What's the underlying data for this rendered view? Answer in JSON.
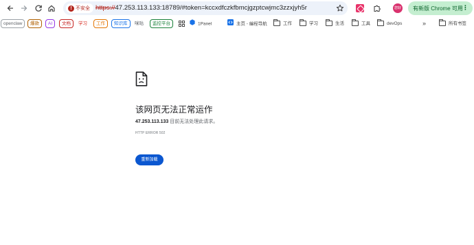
{
  "toolbar": {
    "security_label": "不安全",
    "url_scheme": "https://",
    "url_rest": "47.253.113.133:18789/#token=kccxdfczkfbmcjgzptcwjmc3zzxjyh5r",
    "update_label": "有新版 Chrome 可用",
    "avatar_text": "您好"
  },
  "bookmarks": [
    {
      "label": "openclaw",
      "color": "#5f6368",
      "style": "chip"
    },
    {
      "label": "爆款",
      "color": "#b06000",
      "style": "chip"
    },
    {
      "label": "AI",
      "color": "#9334e6",
      "style": "chip"
    },
    {
      "label": "文档",
      "color": "#c5221f",
      "style": "chip"
    },
    {
      "label": "学习",
      "color": "#d93025",
      "style": "plain"
    },
    {
      "label": "工作",
      "color": "#e37400",
      "style": "chip"
    },
    {
      "label": "知识库",
      "color": "#1a73e8",
      "style": "chip"
    },
    {
      "label": "咪咕",
      "color": "#5f6368",
      "style": "plain"
    },
    {
      "label": "监控平台",
      "color": "#188038",
      "style": "chip"
    },
    {
      "label": "1Panel",
      "icon": "1panel-icon"
    },
    {
      "label": "主页 - 编程导航",
      "icon": "code-nav-icon"
    },
    {
      "label": "工作",
      "icon": "folder-icon"
    },
    {
      "label": "学习",
      "icon": "folder-icon"
    },
    {
      "label": "生活",
      "icon": "folder-icon"
    },
    {
      "label": "工具",
      "icon": "folder-icon"
    },
    {
      "label": "devOps",
      "icon": "folder-icon"
    },
    {
      "label": "所有书签",
      "icon": "folder-icon"
    }
  ],
  "error": {
    "title": "该网页无法正常运作",
    "host": "47.253.113.133",
    "message": " 目前无法处理此请求。",
    "code": "HTTP ERROR 502",
    "reload_label": "重新加载"
  },
  "colors": {
    "accent": "#0b57d0",
    "insecure": "#b3261e",
    "update_chip": "#c4eed0"
  }
}
